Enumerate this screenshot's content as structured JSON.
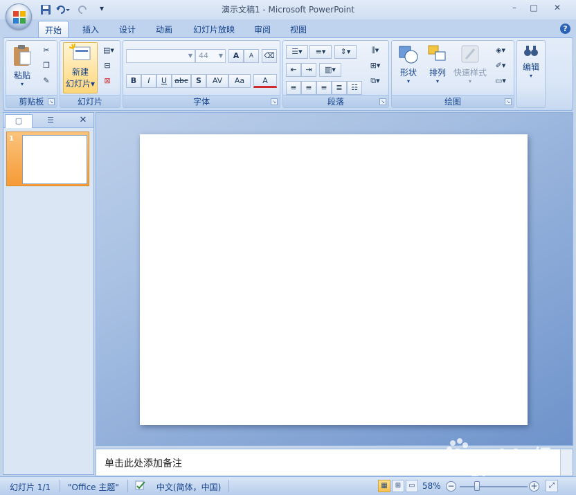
{
  "window": {
    "title": "演示文稿1 - Microsoft PowerPoint",
    "minimize": "–",
    "maximize": "□",
    "close": "✕"
  },
  "qat": {
    "customize": "▾"
  },
  "tabs": [
    {
      "label": "开始"
    },
    {
      "label": "插入"
    },
    {
      "label": "设计"
    },
    {
      "label": "动画"
    },
    {
      "label": "幻灯片放映"
    },
    {
      "label": "审阅"
    },
    {
      "label": "视图"
    }
  ],
  "help": "?",
  "ribbon": {
    "clipboard": {
      "label": "剪贴板",
      "paste": "粘贴"
    },
    "slides": {
      "label": "幻灯片",
      "new_slide_line1": "新建",
      "new_slide_line2": "幻灯片▾"
    },
    "font": {
      "label": "字体",
      "font_size": "44",
      "bold": "B",
      "italic": "I",
      "underline": "U",
      "strike": "abc",
      "shadow": "S",
      "spacing": "AV",
      "case": "Aa",
      "color": "A",
      "grow": "A",
      "shrink": "A"
    },
    "paragraph": {
      "label": "段落"
    },
    "drawing": {
      "label": "绘图",
      "shapes": "形状",
      "arrange": "排列",
      "quick_styles": "快速样式"
    },
    "editing": {
      "label": "编辑"
    }
  },
  "slide_panel": {
    "thumb_number": "1",
    "close": "✕"
  },
  "notes": {
    "placeholder": "单击此处添加备注"
  },
  "status": {
    "slide_count": "幻灯片 1/1",
    "theme": "\"Office 主题\"",
    "language": "中文(简体，中国)",
    "zoom": "58%"
  },
  "watermark": {
    "text": "Baidu经验",
    "sub": "jingyan.baidu.com"
  },
  "colors": {
    "accent": "#15428b",
    "ribbon_bg": "#dfe9f7",
    "slide_selected": "#f69a36",
    "workspace": "#8fadd9"
  }
}
